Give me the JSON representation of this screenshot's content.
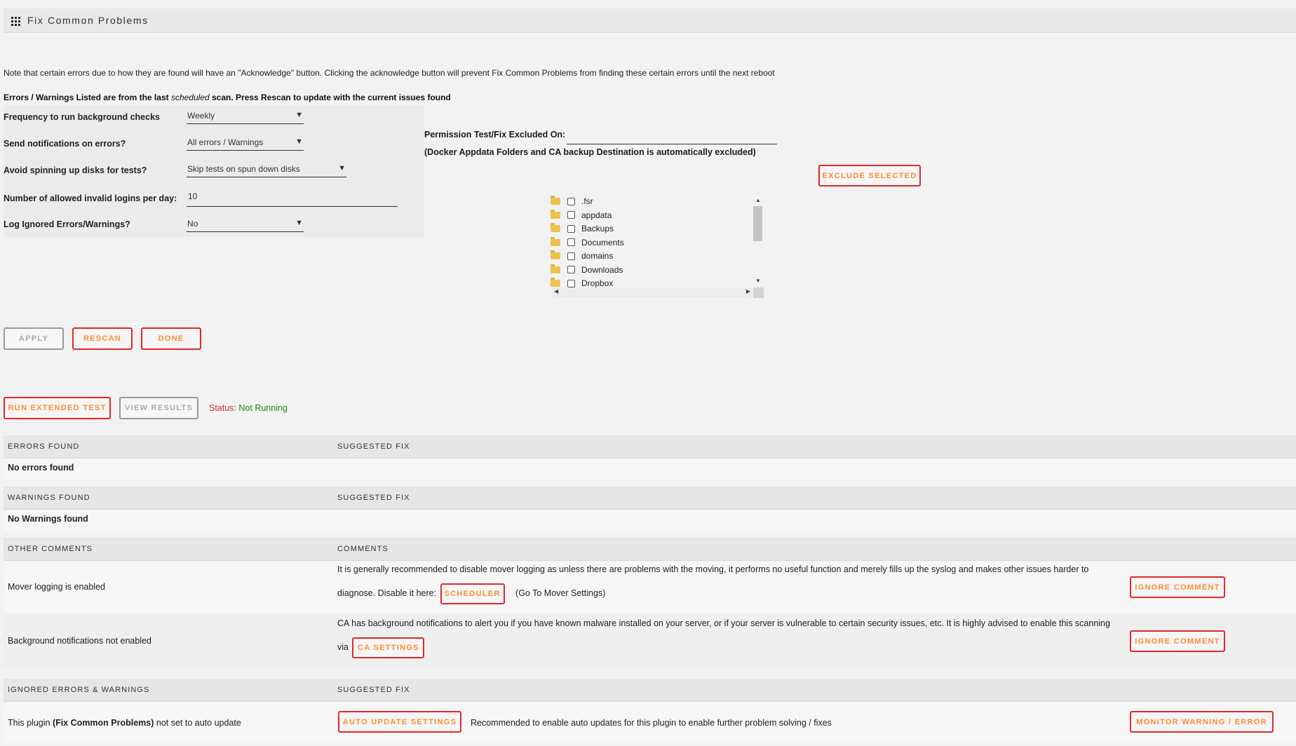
{
  "header": {
    "title": "Fix Common Problems",
    "icon": "grid-icon"
  },
  "notes": {
    "acknowledge": "Note that certain errors due to how they are found will have an \"Acknowledge\" button. Clicking the acknowledge button will prevent Fix Common Problems from finding these certain errors until the next reboot",
    "scan_prefix": "Errors / Warnings Listed are from the last ",
    "scan_em": "scheduled",
    "scan_suffix": " scan. Press Rescan to update with the current issues found"
  },
  "settings": {
    "frequency": {
      "label": "Frequency to run background checks",
      "value": "Weekly"
    },
    "notifications": {
      "label": "Send notifications on errors?",
      "value": "All errors / Warnings"
    },
    "spinup": {
      "label": "Avoid spinning up disks for tests?",
      "value": "Skip tests on spun down disks"
    },
    "logins": {
      "label": "Number of allowed invalid logins per day:",
      "value": "10"
    },
    "log_ignored": {
      "label": "Log Ignored Errors/Warnings?",
      "value": "No"
    }
  },
  "permissions": {
    "excluded_label": "Permission Test/Fix Excluded On:",
    "excluded_value": "",
    "auto_note": "(Docker Appdata Folders and CA backup Destination is automatically excluded)",
    "exclude_button": "Exclude Selected",
    "folders": [
      ".fsr",
      "appdata",
      "Backups",
      "Documents",
      "domains",
      "Downloads",
      "Dropbox"
    ]
  },
  "actions": {
    "apply": "Apply",
    "rescan": "Rescan",
    "done": "Done",
    "run_extended": "Run Extended Test",
    "view_results": "View Results",
    "status_label": "Status:",
    "status_value": "Not Running"
  },
  "errors": {
    "col1": "ERRORS FOUND",
    "col2": "SUGGESTED FIX",
    "empty": "No errors found"
  },
  "warnings": {
    "col1": "WARNINGS FOUND",
    "col2": "SUGGESTED FIX",
    "empty": "No Warnings found"
  },
  "comments": {
    "col1": "OTHER COMMENTS",
    "col2": "COMMENTS",
    "rows": [
      {
        "issue": "Mover logging is enabled",
        "text": "It is generally recommended to disable mover logging as unless there are problems with the moving, it performs no useful function and merely fills up the syslog and makes other issues harder to diagnose. Disable it here:",
        "button": "Scheduler",
        "after": "(Go To Mover Settings)",
        "ignore": "Ignore Comment"
      },
      {
        "issue": "Background notifications not enabled",
        "text": "CA has background notifications to alert you if you have known malware installed on your server, or if your server is vulnerable to certain security issues, etc. It is highly advised to enable this scanning via",
        "button": "CA Settings",
        "after": "",
        "ignore": "Ignore Comment"
      }
    ]
  },
  "ignored": {
    "col1": "IGNORED ERRORS & WARNINGS",
    "col2": "SUGGESTED FIX",
    "rows": [
      {
        "issue_prefix": "This plugin ",
        "issue_bold": "(Fix Common Problems)",
        "issue_suffix": " not set to auto update",
        "fix_button": "Auto Update Settings",
        "fix_text": "Recommended to enable auto updates for this plugin to enable further problem solving / fixes",
        "monitor": "Monitor Warning / Error"
      }
    ]
  },
  "colors": {
    "accent_text": "#ff8c2f",
    "accent_border": "#e22828",
    "status_label": "#c83232",
    "status_value": "#1a8a1a"
  }
}
